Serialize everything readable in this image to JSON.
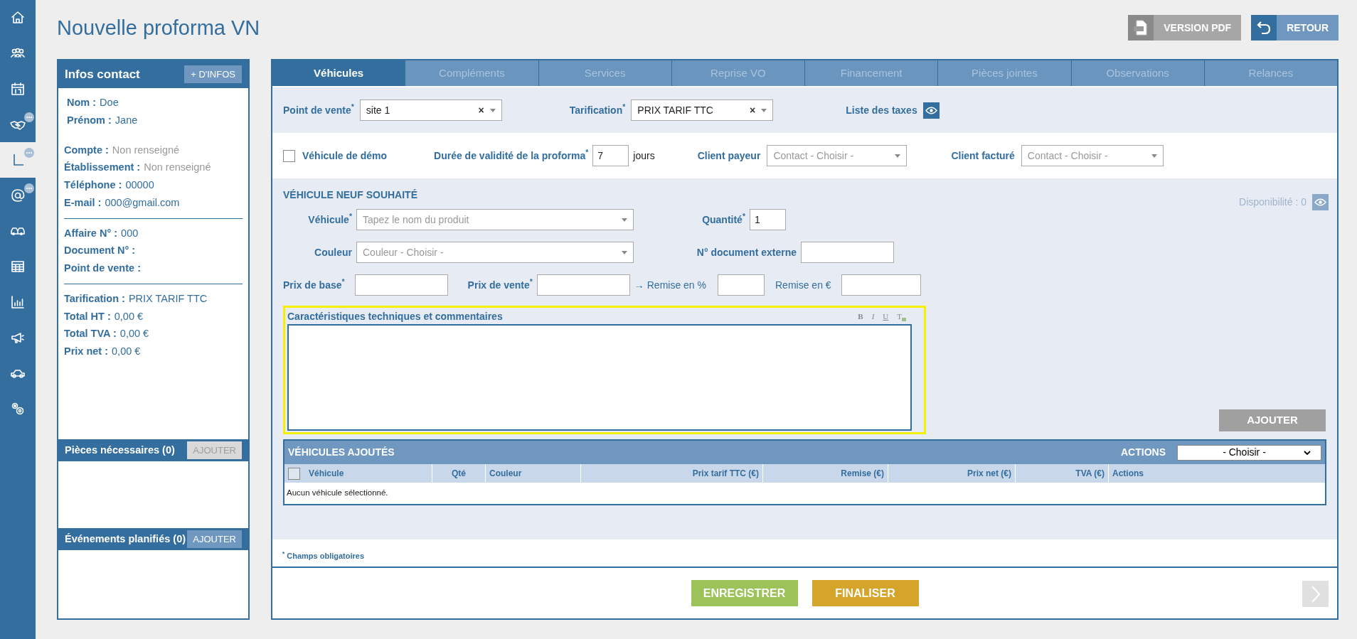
{
  "sidebar": {
    "items": [
      {
        "selected": false,
        "badge": false
      },
      {
        "selected": false,
        "badge": false
      },
      {
        "selected": false,
        "badge": false
      },
      {
        "selected": false,
        "badge": true
      },
      {
        "selected": true,
        "badge": true
      },
      {
        "selected": false,
        "badge": true
      },
      {
        "selected": false,
        "badge": false
      },
      {
        "selected": false,
        "badge": false
      },
      {
        "selected": false,
        "badge": false
      },
      {
        "selected": false,
        "badge": false
      },
      {
        "selected": false,
        "badge": false
      },
      {
        "selected": false,
        "badge": false
      }
    ]
  },
  "page_title": "Nouvelle proforma VN",
  "header_buttons": [
    {
      "kind": "pdf",
      "label": "VERSION PDF"
    },
    {
      "kind": "back",
      "label": "RETOUR"
    }
  ],
  "contact_panel": {
    "title": "Infos contact",
    "button": "+ D'INFOS",
    "groups": [
      [
        {
          "label": "Nom :",
          "value": "Doe",
          "muted": false
        },
        {
          "label": "Prénom :",
          "value": "Jane",
          "muted": false
        }
      ],
      [
        {
          "label": "Compte :",
          "value": "Non renseigné",
          "muted": true
        },
        {
          "label": "Établissement :",
          "value": "Non renseigné",
          "muted": true
        },
        {
          "label": "Téléphone :",
          "value": "00000",
          "muted": false
        },
        {
          "label": "E-mail :",
          "value": "000@gmail.com",
          "muted": false
        }
      ],
      [
        {
          "label": "Affaire N° :",
          "value": "000",
          "muted": false
        },
        {
          "label": "Document N° :"
        },
        {
          "label": "Point de vente :"
        }
      ],
      [
        {
          "label": "Tarification :",
          "value": "PRIX TARIF TTC",
          "muted": false
        },
        {
          "label": "Total HT :",
          "value": "0,00 €",
          "muted": false
        },
        {
          "label": "Total TVA :",
          "value": "0,00 €",
          "muted": false
        },
        {
          "label": "Prix net :",
          "value": "0,00 €",
          "muted": false
        }
      ]
    ]
  },
  "side_sections": [
    {
      "title": "Pièces nécessaires (0)",
      "button": "AJOUTER",
      "disabled": true
    },
    {
      "title": "Événements planifiés (0)",
      "button": "AJOUTER",
      "disabled": false
    }
  ],
  "tabs": [
    {
      "label": "Véhicules",
      "selected": true
    },
    {
      "label": "Compléments",
      "selected": false
    },
    {
      "label": "Services",
      "selected": false
    },
    {
      "label": "Reprise VO",
      "selected": false
    },
    {
      "label": "Financement",
      "selected": false
    },
    {
      "label": "Pièces jointes",
      "selected": false
    },
    {
      "label": "Observations",
      "selected": false
    },
    {
      "label": "Relances",
      "selected": false
    }
  ],
  "point_de_vente": {
    "label": "Point de vente$^{*}$",
    "value": "site 1",
    "clear": "×"
  },
  "tarification": {
    "label": "Tarification$^{*}$",
    "value": "PRIX TARIF TTC",
    "clear": "×"
  },
  "taxes": {
    "label": "Liste des taxes"
  },
  "demo": {
    "label": "Véhicule de démo",
    "checked": false
  },
  "validity": {
    "label": "Durée de validité de la proforma$^{*}$",
    "value": "7",
    "unit": "jours"
  },
  "client_payeur": {
    "label": "Client payeur",
    "placeholder": "Contact - Choisir -"
  },
  "client_facture": {
    "label": "Client facturé",
    "placeholder": "Contact - Choisir -"
  },
  "vehicle_section": {
    "title": "VÉHICULE NEUF SOUHAITÉ",
    "availability": "Disponibilité : 0",
    "vehicle": {
      "label": "Véhicule$^{*}$",
      "placeholder": "Tapez le nom du produit"
    },
    "quantity": {
      "label": "Quantité$^{*}$",
      "value": "1"
    },
    "color": {
      "label": "Couleur",
      "placeholder": "Couleur - Choisir -"
    },
    "external_doc": {
      "label": "N° document externe"
    },
    "base_price": {
      "label": "Prix de base$^{*}$"
    },
    "sale_price": {
      "label": "Prix de vente$^{*}$"
    },
    "discount_pct": {
      "label": "→ Remise en %"
    },
    "discount_eur": {
      "label": "Remise en €"
    },
    "editor": {
      "label": "Caractéristiques techniques et commentaires",
      "toolbar": [
        {
          "kind": "bold",
          "glyph": "B"
        },
        {
          "kind": "italic",
          "glyph": "I"
        },
        {
          "kind": "underline",
          "glyph": "U"
        },
        {
          "kind": "clear",
          "glyph": "T"
        }
      ]
    },
    "add_button": "AJOUTER"
  },
  "vehicles_table": {
    "title": "VÉHICULES AJOUTÉS",
    "actions_label": "ACTIONS",
    "actions_value": "- Choisir -",
    "select_all": {
      "checked": false
    },
    "columns": [
      "Véhicule",
      "Qté",
      "Couleur",
      "Prix tarif TTC (€)",
      "Remise (€)",
      "Prix net (€)",
      "TVA (€)",
      "Actions"
    ],
    "empty": "Aucun véhicule sélectionné."
  },
  "required_note": "$^{*}$ Champs obligatoires",
  "footer_buttons": [
    {
      "kind": "save",
      "label": "ENREGISTRER"
    },
    {
      "kind": "finish",
      "label": "FINALISER"
    }
  ]
}
